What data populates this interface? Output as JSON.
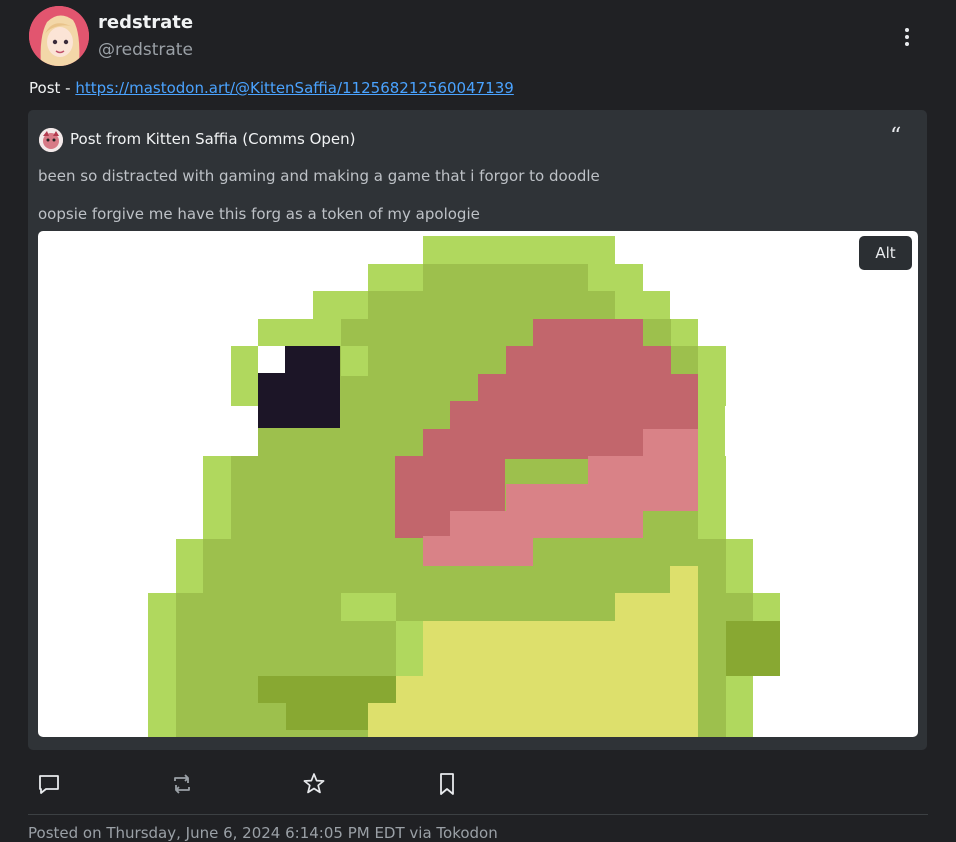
{
  "author": {
    "display_name": "redstrate",
    "handle": "@redstrate"
  },
  "post": {
    "prefix": "Post - ",
    "link": "https://mastodon.art/@KittenSaffia/112568212560047139"
  },
  "quoted_post": {
    "title": "Post from Kitten Saffia (Comms Open)",
    "quote_mark": "“",
    "text_line_1": "been so distracted with gaming and making a game that i forgor to doodle",
    "text_line_2": "oopsie forgive me have this forg as a token of my apologie",
    "media": {
      "alt_label": "Alt"
    }
  },
  "actions": [
    {
      "icon": "reply-icon"
    },
    {
      "icon": "boost-icon"
    },
    {
      "icon": "favorite-icon"
    },
    {
      "icon": "bookmark-icon"
    }
  ],
  "footer": {
    "text": "Posted on Thursday, June 6, 2024 6:14:05 PM EDT via Tokodon"
  },
  "colors": {
    "background": "#202124",
    "card": "#2f3337",
    "link": "#4aa3ff"
  }
}
